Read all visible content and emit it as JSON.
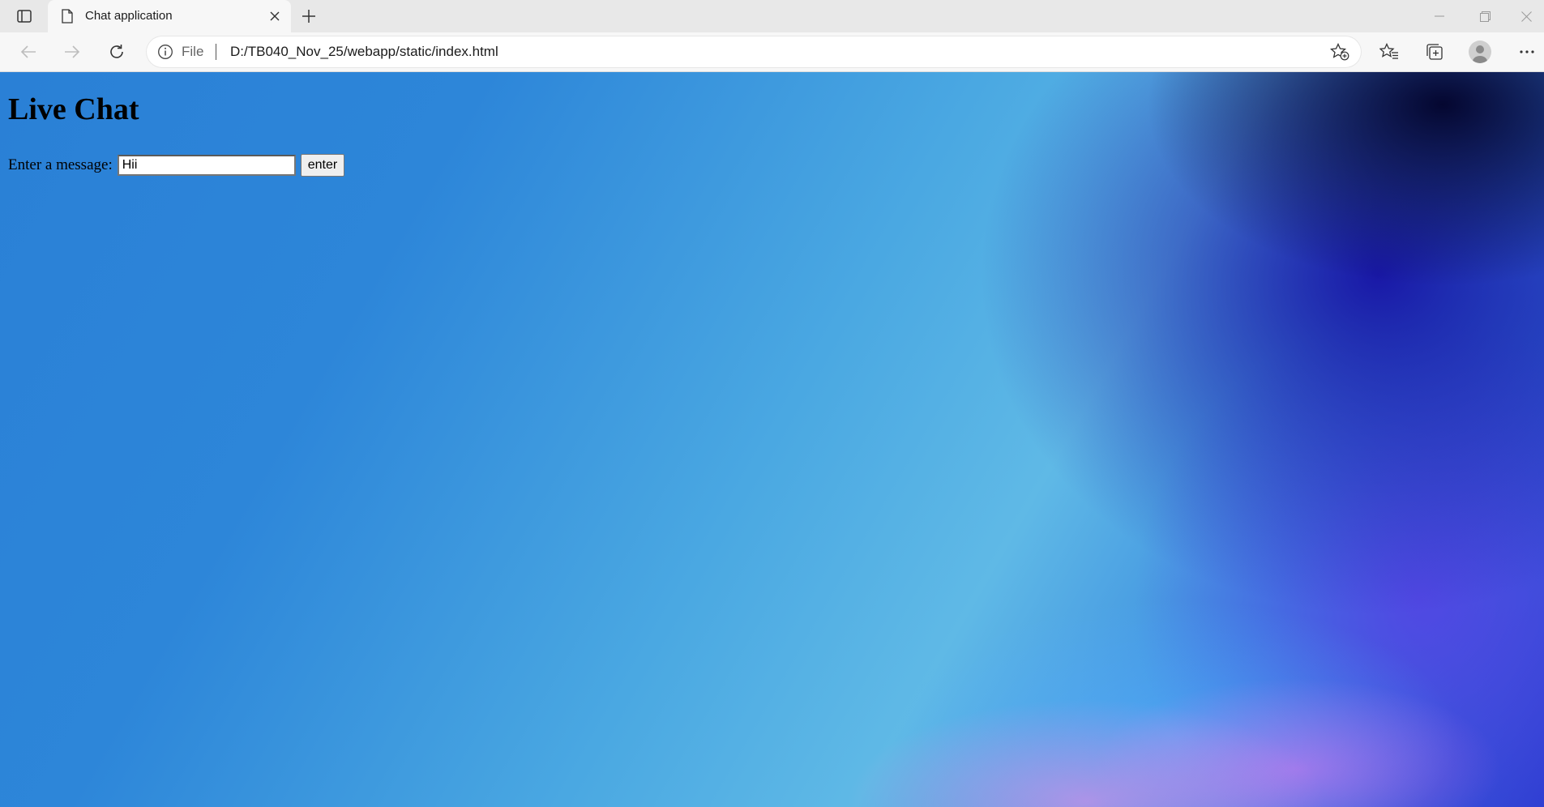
{
  "browser": {
    "tab": {
      "title": "Chat application"
    },
    "address_bar": {
      "site_info_label": "File",
      "url": "D:/TB040_Nov_25/webapp/static/index.html"
    },
    "icons": {
      "tab_actions": "tab-actions-icon",
      "favicon": "page-icon",
      "tab_close": "close-icon",
      "new_tab": "plus-icon",
      "back": "arrow-left-icon",
      "forward": "arrow-right-icon",
      "reload": "reload-icon",
      "site_info": "info-icon",
      "add_favorite": "star-plus-icon",
      "favorites": "favorites-icon",
      "collections": "collections-icon",
      "profile": "profile-icon",
      "more": "more-icon",
      "minimize": "minimize-icon",
      "restore": "restore-icon",
      "close_window": "close-icon"
    }
  },
  "page": {
    "heading": "Live Chat",
    "form": {
      "label": "Enter a message:",
      "input_value": "Hii",
      "button_label": "enter"
    }
  }
}
